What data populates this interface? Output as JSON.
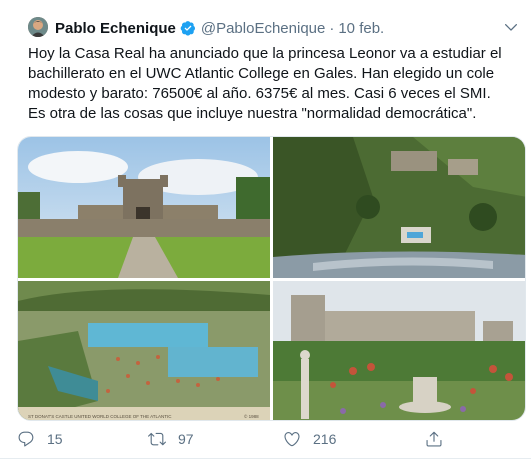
{
  "tweet": {
    "author_name": "Pablo Echenique",
    "handle": "@PabloEchenique",
    "separator": "·",
    "date": "10 feb.",
    "text": "Hoy la Casa Real ha anunciado que la princesa Leonor va a estudiar el bachillerato en el UWC Atlantic College en Gales. Han elegido un cole modesto y barato: 76500€ al año. 6375€ al mes. Casi 6 veces el SMI. Es otra de las cosas que incluye nuestra \"normalidad democrática\".",
    "image_caption": "ST DONAT'S CASTLE   UNITED WORLD COLLEGE OF THE ATLANTIC",
    "image_credit": "© 1988"
  },
  "actions": {
    "replies": "15",
    "retweets": "97",
    "likes": "216"
  },
  "icons": {
    "avatar": "avatar",
    "verified": "verified-badge-icon",
    "more": "chevron-down-icon",
    "reply": "reply-icon",
    "retweet": "retweet-icon",
    "like": "heart-icon",
    "share": "share-icon"
  },
  "colors": {
    "accent": "#1da1f2",
    "secondary_text": "#5b7083"
  }
}
